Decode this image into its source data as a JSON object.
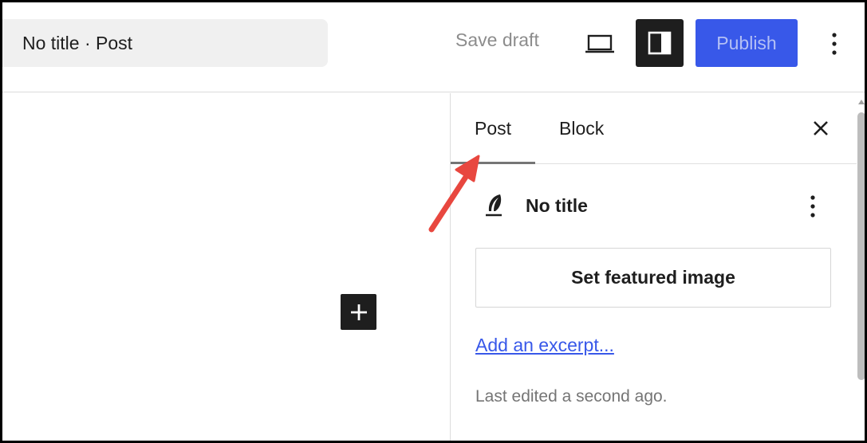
{
  "header": {
    "document_title": "No title · Post",
    "save_draft_label": "Save draft",
    "publish_label": "Publish"
  },
  "sidebar": {
    "tabs": [
      {
        "label": "Post",
        "active": true
      },
      {
        "label": "Block",
        "active": false
      }
    ],
    "post_title": "No title",
    "featured_image_label": "Set featured image",
    "excerpt_link": "Add an excerpt...",
    "last_edited": "Last edited a second ago."
  },
  "icons": {
    "preview": "laptop-icon",
    "settings": "sidebar-toggle-icon",
    "options": "vertical-ellipsis-icon",
    "inserter": "plus-icon",
    "close": "close-icon",
    "post": "feather-icon"
  },
  "colors": {
    "accent": "#3858e9",
    "dark": "#1e1e1e",
    "annotation_arrow": "#e8473f"
  }
}
